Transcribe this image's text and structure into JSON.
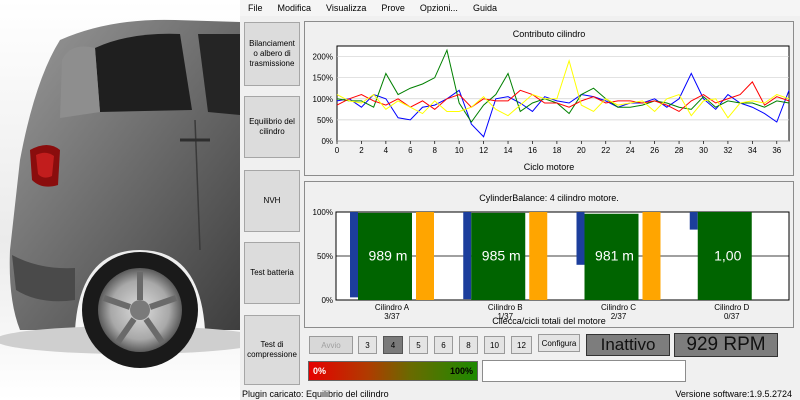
{
  "menu": [
    "File",
    "Modifica",
    "Visualizza",
    "Prove",
    "Opzioni...",
    "Guida"
  ],
  "side_buttons": [
    "Bilanciament o albero di trasmissione",
    "Equilibrio del cilindro",
    "NVH",
    "Test batteria",
    "Test di compressione"
  ],
  "line_chart": {
    "title": "Contributo cilindro",
    "xlabel": "Ciclo motore",
    "y_ticks": [
      "0%",
      "50%",
      "100%",
      "150%",
      "200%"
    ],
    "x_ticks": [
      "0",
      "2",
      "4",
      "6",
      "8",
      "10",
      "12",
      "14",
      "16",
      "18",
      "20",
      "22",
      "24",
      "26",
      "28",
      "30",
      "32",
      "34",
      "36"
    ]
  },
  "bar_chart": {
    "title": "CylinderBalance: 4 cilindro motore.",
    "xlabel": "Cilecca/cicli totali del motore",
    "y_ticks": [
      "0%",
      "50%",
      "100%"
    ],
    "cylinders": [
      {
        "name": "Cilindro A",
        "count": "3/37",
        "value_text": "989 m"
      },
      {
        "name": "Cilindro B",
        "count": "1/37",
        "value_text": "985 m"
      },
      {
        "name": "Cilindro C",
        "count": "2/37",
        "value_text": "981 m"
      },
      {
        "name": "Cilindro D",
        "count": "0/37",
        "value_text": "1,00"
      }
    ]
  },
  "controls": {
    "start_label": "Avvio",
    "cylinder_options": [
      "3",
      "4",
      "5",
      "6",
      "8",
      "10",
      "12"
    ],
    "selected_cylinders": "4",
    "configure_label": "Configura",
    "status": "Inattivo",
    "rpm": "929 RPM",
    "progress_min": "0%",
    "progress_max": "100%",
    "text_value": ""
  },
  "statusbar": {
    "plugin": "Plugin caricato: Equilibrio del cilindro",
    "version": "Versione software:1.9.5.2724"
  },
  "chart_data": [
    {
      "type": "line",
      "title": "Contributo cilindro",
      "xlabel": "Ciclo motore",
      "ylabel": "",
      "xlim": [
        0,
        37
      ],
      "ylim": [
        0,
        225
      ],
      "x": [
        0,
        1,
        2,
        3,
        4,
        5,
        6,
        7,
        8,
        9,
        10,
        11,
        12,
        13,
        14,
        15,
        16,
        17,
        18,
        19,
        20,
        21,
        22,
        23,
        24,
        25,
        26,
        27,
        28,
        29,
        30,
        31,
        32,
        33,
        34,
        35,
        36,
        37
      ],
      "series": [
        {
          "color": "#0000ff",
          "values": [
            95,
            100,
            80,
            110,
            100,
            55,
            50,
            80,
            85,
            100,
            120,
            40,
            10,
            100,
            105,
            90,
            70,
            105,
            95,
            90,
            110,
            105,
            95,
            80,
            90,
            90,
            100,
            80,
            100,
            160,
            100,
            75,
            110,
            90,
            80,
            65,
            45,
            120
          ]
        },
        {
          "color": "#008000",
          "values": [
            100,
            95,
            95,
            80,
            160,
            110,
            125,
            135,
            150,
            215,
            90,
            45,
            85,
            110,
            160,
            70,
            90,
            100,
            90,
            65,
            110,
            125,
            100,
            80,
            80,
            85,
            95,
            90,
            80,
            75,
            105,
            80,
            95,
            90,
            90,
            80,
            95,
            90
          ]
        },
        {
          "color": "#ff0000",
          "values": [
            85,
            100,
            110,
            95,
            85,
            100,
            80,
            95,
            75,
            100,
            110,
            80,
            100,
            95,
            95,
            120,
            110,
            90,
            90,
            80,
            95,
            105,
            90,
            95,
            95,
            90,
            95,
            85,
            70,
            95,
            110,
            90,
            100,
            110,
            140,
            85,
            105,
            95
          ]
        },
        {
          "color": "#ffff00",
          "values": [
            110,
            95,
            90,
            110,
            75,
            95,
            80,
            65,
            95,
            70,
            70,
            80,
            105,
            75,
            60,
            85,
            110,
            100,
            100,
            190,
            85,
            70,
            100,
            85,
            90,
            95,
            70,
            100,
            110,
            60,
            95,
            100,
            55,
            90,
            95,
            90,
            110,
            100
          ]
        }
      ]
    },
    {
      "type": "bar",
      "title": "CylinderBalance: 4 cilindro motore.",
      "xlabel": "Cilecca/cicli totali del motore",
      "ylim": [
        0,
        100
      ],
      "categories": [
        "Cilindro A",
        "Cilindro B",
        "Cilindro C",
        "Cilindro D"
      ],
      "series": [
        {
          "color": "#1c3e9c",
          "values": [
            100,
            100,
            100,
            100
          ],
          "low_values": [
            3,
            1,
            40,
            80
          ]
        },
        {
          "color": "#006400",
          "values": [
            99,
            99,
            98,
            100
          ]
        },
        {
          "color": "#ffa500",
          "values": [
            100,
            100,
            100,
            0
          ]
        }
      ]
    }
  ]
}
